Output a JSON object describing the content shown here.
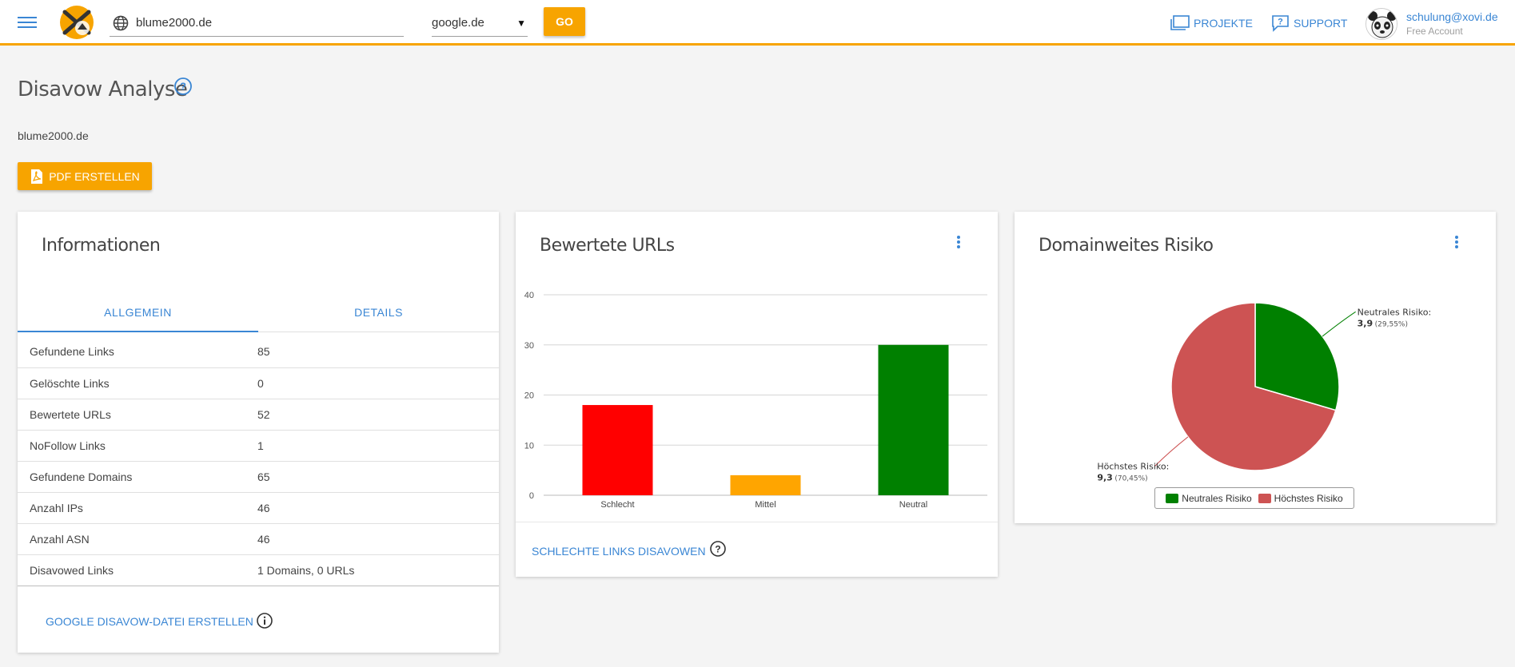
{
  "header": {
    "domain_value": "blume2000.de",
    "engine_value": "google.de",
    "go_label": "GO",
    "projects_label": "PROJEKTE",
    "support_label": "SUPPORT",
    "user_email": "schulung@xovi.de",
    "user_plan": "Free Account"
  },
  "page": {
    "title": "Disavow Analyse",
    "domain": "blume2000.de",
    "pdf_button": "PDF ERSTELLEN"
  },
  "info_card": {
    "title": "Informationen",
    "tabs": [
      {
        "label": "ALLGEMEIN",
        "active": true
      },
      {
        "label": "DETAILS",
        "active": false
      }
    ],
    "rows": [
      {
        "label": "Gefundene Links",
        "value": "85"
      },
      {
        "label": "Gelöschte Links",
        "value": "0"
      },
      {
        "label": "Bewertete URLs",
        "value": "52"
      },
      {
        "label": "NoFollow Links",
        "value": "1"
      },
      {
        "label": "Gefundene Domains",
        "value": "65"
      },
      {
        "label": "Anzahl IPs",
        "value": "46"
      },
      {
        "label": "Anzahl ASN",
        "value": "46"
      },
      {
        "label": "Disavowed Links",
        "value": "1 Domains, 0 URLs"
      }
    ],
    "action": "GOOGLE DISAVOW-DATEI ERSTELLEN"
  },
  "urls_card": {
    "title": "Bewertete URLs",
    "action": "SCHLECHTE LINKS DISAVOWEN"
  },
  "risk_card": {
    "title": "Domainweites Risiko"
  },
  "colors": {
    "accent": "#f7a400",
    "link": "#3a86d4",
    "bad": "#ff0000",
    "medium": "#ffa500",
    "neutral": "#008000",
    "highest_risk": "#cd5353"
  },
  "chart_data": [
    {
      "type": "bar",
      "categories": [
        "Schlecht",
        "Mittel",
        "Neutral"
      ],
      "values": [
        18,
        4,
        30
      ],
      "colors": [
        "#ff0000",
        "#ffa500",
        "#008000"
      ],
      "yticks": [
        "0",
        "10",
        "20",
        "30",
        "40"
      ],
      "ylim": [
        0,
        40
      ],
      "grid": true
    },
    {
      "type": "pie",
      "slices": [
        {
          "name": "Neutrales Risiko",
          "value": 3.9,
          "value_label": "3,9",
          "percent_label": "(29,55%)",
          "percent": 29.55,
          "color": "#008000"
        },
        {
          "name": "Höchstes Risiko",
          "value": 9.3,
          "value_label": "9,3",
          "percent_label": "(70,45%)",
          "percent": 70.45,
          "color": "#cd5353"
        }
      ],
      "legend": "bottom"
    }
  ]
}
